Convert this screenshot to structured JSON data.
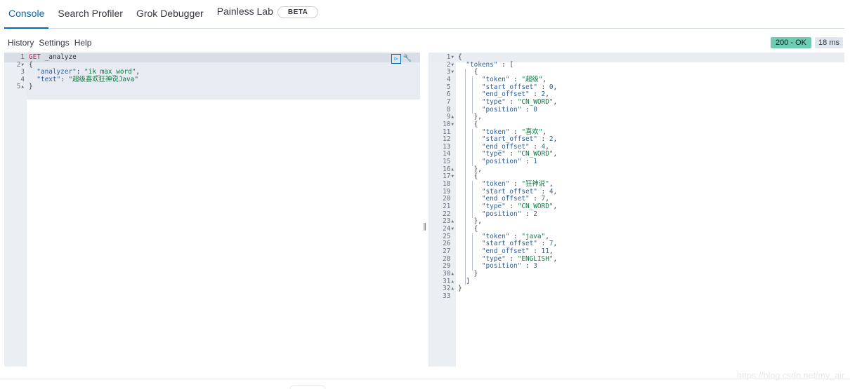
{
  "tabs": [
    {
      "label": "Console",
      "active": true
    },
    {
      "label": "Search Profiler"
    },
    {
      "label": "Grok Debugger"
    },
    {
      "label": "Painless Lab",
      "badge": "BETA"
    }
  ],
  "toolbar": {
    "history": "History",
    "settings": "Settings",
    "help": "Help"
  },
  "status": {
    "code": "200 - OK",
    "time": "18 ms"
  },
  "request": {
    "lines": [
      {
        "n": "1",
        "fold": "",
        "method": "GET",
        "path": " _analyze"
      },
      {
        "n": "2",
        "fold": "▾",
        "text": "{"
      },
      {
        "n": "3",
        "fold": "",
        "key": "\"analyzer\"",
        "sep": ": ",
        "val": "\"ik_max_word\"",
        "end": ","
      },
      {
        "n": "4",
        "fold": "",
        "key": "\"text\"",
        "sep": ": ",
        "val": "\"超级喜欢狂神说Java\"",
        "end": ""
      },
      {
        "n": "5",
        "fold": "▴",
        "text": "}"
      }
    ]
  },
  "response": {
    "lines": [
      "{",
      "  \"tokens\" : [",
      "    {",
      "      \"token\" : \"超级\",",
      "      \"start_offset\" : 0,",
      "      \"end_offset\" : 2,",
      "      \"type\" : \"CN_WORD\",",
      "      \"position\" : 0",
      "    },",
      "    {",
      "      \"token\" : \"喜欢\",",
      "      \"start_offset\" : 2,",
      "      \"end_offset\" : 4,",
      "      \"type\" : \"CN_WORD\",",
      "      \"position\" : 1",
      "    },",
      "    {",
      "      \"token\" : \"狂神说\",",
      "      \"start_offset\" : 4,",
      "      \"end_offset\" : 7,",
      "      \"type\" : \"CN_WORD\",",
      "      \"position\" : 2",
      "    },",
      "    {",
      "      \"token\" : \"java\",",
      "      \"start_offset\" : 7,",
      "      \"end_offset\" : 11,",
      "      \"type\" : \"ENGLISH\",",
      "      \"position\" : 3",
      "    }",
      "  ]",
      "}",
      ""
    ],
    "folds": [
      "▾",
      "▾",
      "▾",
      "",
      "",
      "",
      "",
      "",
      "▴",
      "▾",
      "",
      "",
      "",
      "",
      "",
      "▴",
      "▾",
      "",
      "",
      "",
      "",
      "",
      "▴",
      "▾",
      "",
      "",
      "",
      "",
      "",
      "▴",
      "▴",
      "▴",
      ""
    ]
  },
  "watermark": "https://blog.csdn.net/my_air",
  "icons": {
    "run": "play-icon",
    "wrench": "wrench-icon"
  },
  "colors": {
    "accent": "#006bb4",
    "ok_badge": "#6dccb1"
  }
}
